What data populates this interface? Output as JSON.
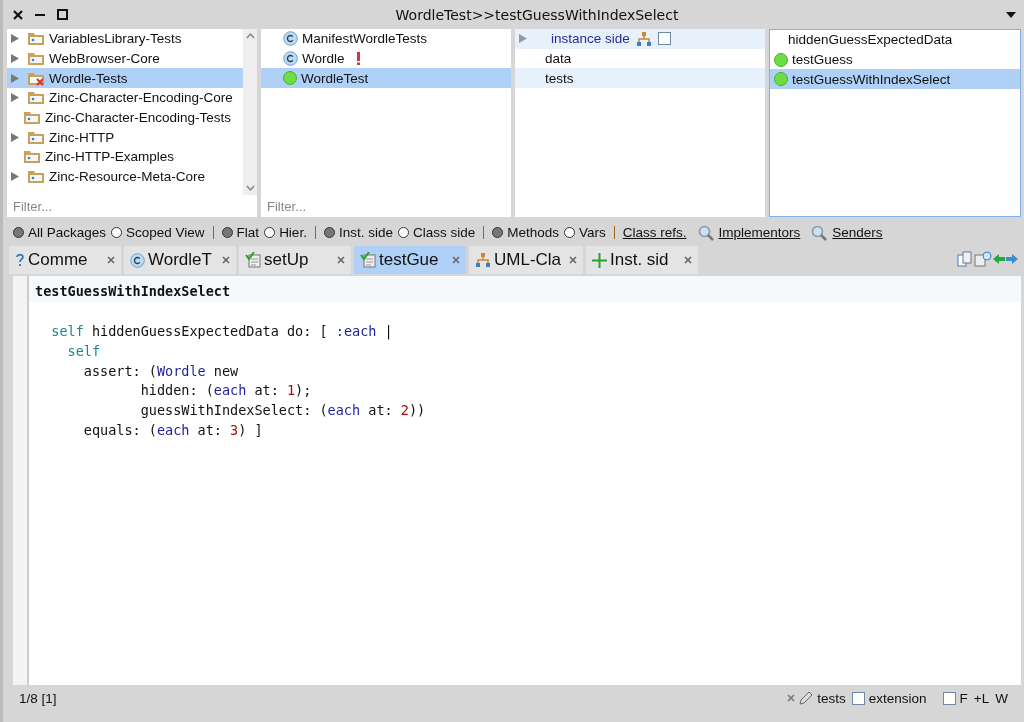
{
  "window": {
    "title": "WordleTest>>testGuessWithIndexSelect"
  },
  "packages": {
    "items": [
      {
        "name": "VariablesLibrary-Tests",
        "expandable": true,
        "selected": false,
        "kind": "package"
      },
      {
        "name": "WebBrowser-Core",
        "expandable": true,
        "selected": false,
        "kind": "package"
      },
      {
        "name": "Wordle-Tests",
        "expandable": true,
        "selected": true,
        "kind": "test-package"
      },
      {
        "name": "Zinc-Character-Encoding-Core",
        "expandable": true,
        "selected": false,
        "kind": "package"
      },
      {
        "name": "Zinc-Character-Encoding-Tests",
        "expandable": false,
        "selected": false,
        "kind": "package"
      },
      {
        "name": "Zinc-HTTP",
        "expandable": true,
        "selected": false,
        "kind": "package"
      },
      {
        "name": "Zinc-HTTP-Examples",
        "expandable": false,
        "selected": false,
        "kind": "package"
      },
      {
        "name": "Zinc-Resource-Meta-Core",
        "expandable": true,
        "selected": false,
        "kind": "package"
      }
    ],
    "filter": {
      "placeholder": "Filter..."
    }
  },
  "classes": {
    "items": [
      {
        "name": "ManifestWordleTests",
        "kind": "class",
        "warning": false,
        "selected": false
      },
      {
        "name": "Wordle",
        "kind": "class",
        "warning": true,
        "selected": false
      },
      {
        "name": "WordleTest",
        "kind": "test-pass",
        "warning": false,
        "selected": true
      }
    ],
    "filter": {
      "placeholder": "Filter..."
    }
  },
  "protocols": {
    "side": {
      "label": "instance side",
      "checked": false
    },
    "items": [
      {
        "name": "data",
        "selected": false
      },
      {
        "name": "tests",
        "selected": true
      }
    ]
  },
  "methods": {
    "items": [
      {
        "name": "hiddenGuessExpectedData",
        "kind": "plain",
        "selected": false
      },
      {
        "name": "testGuess",
        "kind": "test-pass",
        "selected": false
      },
      {
        "name": "testGuessWithIndexSelect",
        "kind": "test-pass",
        "selected": true
      }
    ]
  },
  "toolbar": {
    "radio_groups": [
      [
        {
          "label": "All Packages",
          "selected": true
        },
        {
          "label": "Scoped View",
          "selected": false
        }
      ],
      [
        {
          "label": "Flat",
          "selected": true
        },
        {
          "label": "Hier.",
          "selected": false
        }
      ],
      [
        {
          "label": "Inst. side",
          "selected": true
        },
        {
          "label": "Class side",
          "selected": false
        }
      ],
      [
        {
          "label": "Methods",
          "selected": true
        },
        {
          "label": "Vars",
          "selected": false
        }
      ]
    ],
    "links": [
      {
        "label": "Class refs.",
        "kind": "plain"
      },
      {
        "label": "Implementors",
        "kind": "search"
      },
      {
        "label": "Senders",
        "kind": "search"
      }
    ]
  },
  "tabs": [
    {
      "label": "Comme",
      "kind": "comment",
      "selected": false
    },
    {
      "label": "WordleT",
      "kind": "class",
      "selected": false
    },
    {
      "label": "setUp",
      "kind": "method",
      "selected": false
    },
    {
      "label": "testGue",
      "kind": "method",
      "selected": true
    },
    {
      "label": "UML-Cla",
      "kind": "uml",
      "selected": false
    },
    {
      "label": "Inst. sid",
      "kind": "add",
      "selected": false
    }
  ],
  "editor": {
    "selector": "testGuessWithIndexSelect",
    "lines": [
      [
        {
          "text": "  self",
          "kind": "pseudo"
        },
        {
          "text": " hiddenGuessExpectedData do: [ ",
          "kind": "plain"
        },
        {
          "text": ":each",
          "kind": "var"
        },
        {
          "text": " |",
          "kind": "plain"
        }
      ],
      [
        {
          "text": "    self",
          "kind": "pseudo"
        }
      ],
      [
        {
          "text": "      assert: (",
          "kind": "plain"
        },
        {
          "text": "Wordle",
          "kind": "var"
        },
        {
          "text": " new",
          "kind": "plain"
        }
      ],
      [
        {
          "text": "             hidden: (",
          "kind": "plain"
        },
        {
          "text": "each",
          "kind": "var"
        },
        {
          "text": " at: ",
          "kind": "plain"
        },
        {
          "text": "1",
          "kind": "number"
        },
        {
          "text": ");",
          "kind": "plain"
        }
      ],
      [
        {
          "text": "             guessWithIndexSelect: (",
          "kind": "plain"
        },
        {
          "text": "each",
          "kind": "var"
        },
        {
          "text": " at: ",
          "kind": "plain"
        },
        {
          "text": "2",
          "kind": "number"
        },
        {
          "text": "))",
          "kind": "plain"
        }
      ],
      [
        {
          "text": "      equals: (",
          "kind": "plain"
        },
        {
          "text": "each",
          "kind": "var"
        },
        {
          "text": " at: ",
          "kind": "plain"
        },
        {
          "text": "3",
          "kind": "number"
        },
        {
          "text": ") ]",
          "kind": "plain"
        }
      ]
    ]
  },
  "status_bar": {
    "position": "1/8 [1]",
    "protocol": "tests",
    "extension": {
      "label": "extension",
      "checked": false
    },
    "format": {
      "label": "F",
      "checked": false
    },
    "line_numbers": "+L",
    "wrap": "W"
  }
}
